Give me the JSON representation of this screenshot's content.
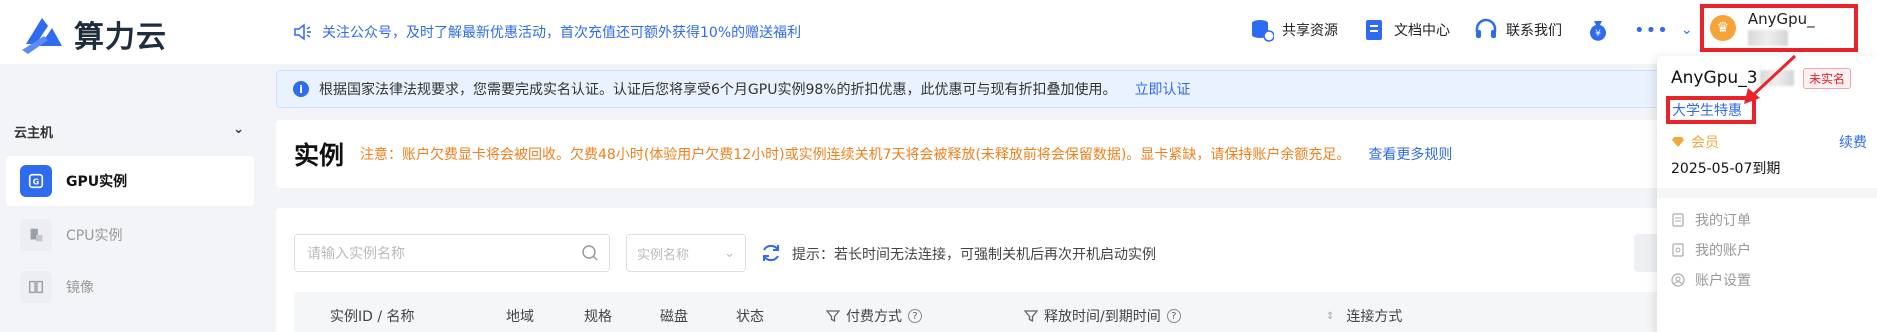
{
  "brand": {
    "name": "算力云"
  },
  "header": {
    "notice": "关注公众号，及时了解最新优惠活动，首次充值还可额外获得10%的赠送福利",
    "actions": [
      {
        "label": "共享资源",
        "icon": "database-share-icon"
      },
      {
        "label": "文档中心",
        "icon": "document-icon"
      },
      {
        "label": "联系我们",
        "icon": "headset-icon"
      }
    ],
    "more": "•••",
    "user": {
      "name": "AnyGpu_"
    }
  },
  "sidebar": {
    "section": "云主机",
    "items": [
      {
        "label": "GPU实例",
        "active": true
      },
      {
        "label": "CPU实例",
        "active": false
      },
      {
        "label": "镜像",
        "active": false
      }
    ]
  },
  "alert": {
    "text": "根据国家法律法规要求，您需要完成实名认证。认证后您将享受6个月GPU实例98%的折扣优惠，此优惠可与现有折扣叠加使用。",
    "link": "立即认证"
  },
  "instances": {
    "title": "实例",
    "warning": "注意：账户欠费显卡将会被回收。欠费48小时(体验用户欠费12小时)或实例连续关机7天将会被释放(未释放前将会保留数据)。显卡紧缺，请保持账户余额充足。",
    "rules_link": "查看更多规则",
    "search_placeholder": "请输入实例名称",
    "filter_select": "实例名称",
    "tip": "提示：若长时间无法连接，可强制关机后再次开机启动实例",
    "columns": [
      "实例ID / 名称",
      "地域",
      "规格",
      "磁盘",
      "状态",
      "付费方式",
      "释放时间/到期时间",
      "连接方式"
    ]
  },
  "dropdown": {
    "name": "AnyGpu_3",
    "unverified": "未实名",
    "student": "大学生特惠",
    "member": "会员",
    "renew": "续费",
    "expiry": "2025-05-07到期",
    "menu": [
      "我的订单",
      "我的账户",
      "账户设置"
    ]
  },
  "colors": {
    "accent": "#2f6bf0",
    "warning": "#f0801c",
    "highlight": "#e8232a"
  }
}
